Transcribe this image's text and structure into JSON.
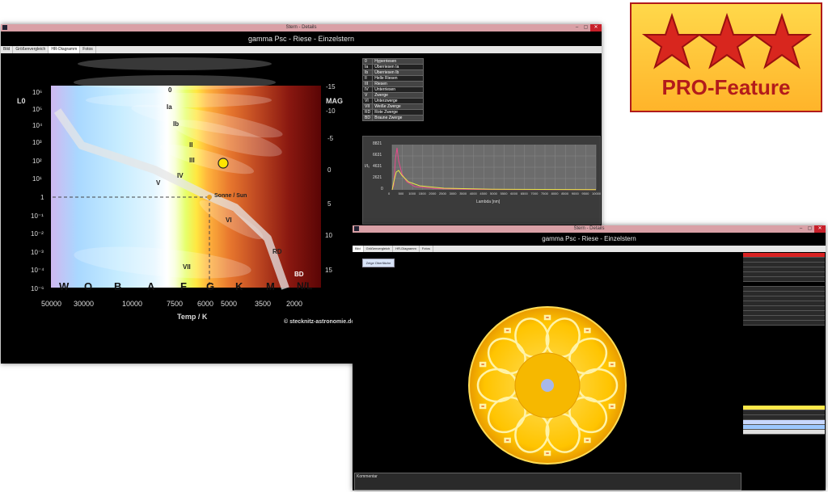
{
  "window1": {
    "title": "Stern - Details",
    "subtitle": "gamma Psc - Riese - Einzelstern",
    "tabs": [
      "Bild",
      "Größenvergleich",
      "HR-Diagramm",
      "Fotos"
    ],
    "buttons": {
      "min": "–",
      "max": "▢",
      "close": "✕"
    },
    "hr": {
      "left_axis_label": "L0",
      "right_axis_label": "MAG",
      "x_axis_label": "Temp / K",
      "copyright": "© stecknitz-astronomie.de",
      "lum_ticks": [
        "10⁶",
        "10⁵",
        "10⁴",
        "10³",
        "10²",
        "10¹",
        "1",
        "10⁻¹",
        "10⁻²",
        "10⁻³",
        "10⁻⁴",
        "10⁻⁶"
      ],
      "mag_ticks": [
        "-15",
        "-10",
        "-5",
        "0",
        "5",
        "10",
        "15"
      ],
      "temp_ticks": [
        "50000",
        "30000",
        "10000",
        "7500",
        "6000",
        "5000",
        "3500",
        "2000"
      ],
      "spectral_classes": [
        "W",
        "O",
        "B",
        "A",
        "F",
        "G",
        "K",
        "M",
        "N/L"
      ],
      "lum_classes": [
        "0",
        "Ia",
        "Ib",
        "II",
        "III",
        "IV",
        "V",
        "VI",
        "VII",
        "RD",
        "BD"
      ],
      "sun_label": "Sonne / Sun"
    },
    "legend": [
      [
        "0",
        "Hyperriesen"
      ],
      [
        "Ia",
        "Überriesen Ia"
      ],
      [
        "Ib",
        "Überriesen Ib"
      ],
      [
        "II",
        "Helle Riesen"
      ],
      [
        "III",
        "Riesen"
      ],
      [
        "IV",
        "Unterriesen"
      ],
      [
        "V",
        "Zwerge"
      ],
      [
        "VI",
        "Unterzwerge"
      ],
      [
        "VII",
        "Weiße Zwerge"
      ],
      [
        "RD",
        "Rote Zwerge"
      ],
      [
        "BD",
        "Braune Zwerge"
      ]
    ],
    "spectrum": {
      "y_ticks": [
        "8821",
        "6631",
        "4631",
        "2621",
        "0"
      ],
      "x_ticks": [
        "0",
        "500",
        "1000",
        "1500",
        "2000",
        "2500",
        "3000",
        "3500",
        "4000",
        "4500",
        "5000",
        "5500",
        "6000",
        "6500",
        "7000",
        "7500",
        "8000",
        "8500",
        "9000",
        "9500",
        "10000"
      ],
      "x_label": "Lambda [nm]",
      "y_label": "I/I₀"
    }
  },
  "pro_badge": {
    "text": "PRO-Feature",
    "color": "#b31b1b"
  },
  "window2": {
    "title": "Stern - Details",
    "subtitle": "gamma Psc - Riese - Einzelstern",
    "tabs": [
      "Bild",
      "Größenvergleich",
      "HR-Diagramm",
      "Fotos"
    ],
    "button_label": "Zeige Oberfläche",
    "comment_label": "Kommentar"
  }
}
